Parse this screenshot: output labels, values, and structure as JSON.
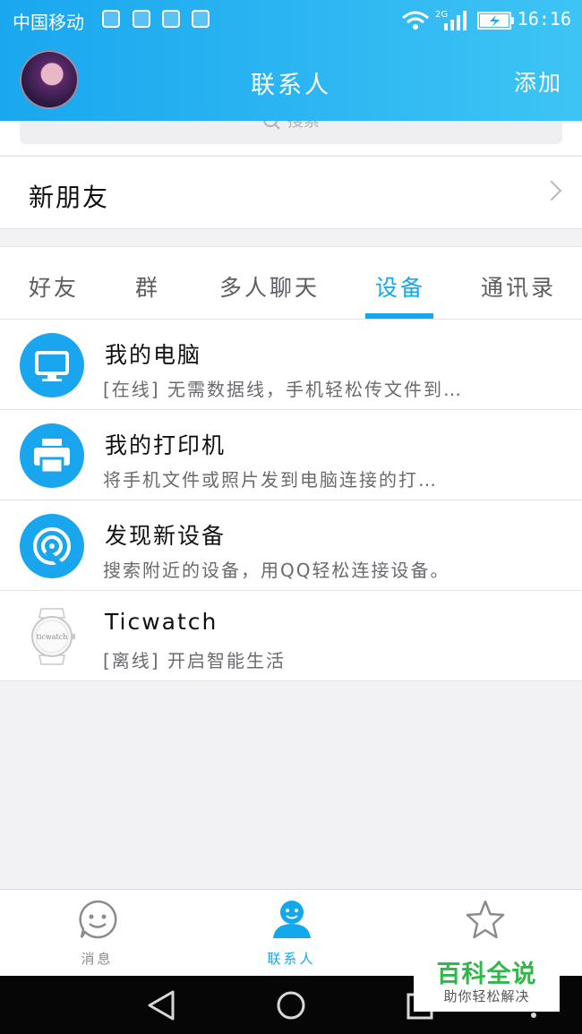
{
  "status_bar": {
    "carrier": "中国移动",
    "network": "2G",
    "time": "16:16",
    "notification_icons": [
      "notification-app-icon",
      "notification-mic-icon",
      "notification-android-icon",
      "notification-gallery-icon"
    ]
  },
  "header": {
    "title": "联系人",
    "add_label": "添加"
  },
  "search": {
    "placeholder": "搜索"
  },
  "new_friends": {
    "label": "新朋友"
  },
  "tabs": [
    {
      "label": "好友",
      "active": false
    },
    {
      "label": "群",
      "active": false
    },
    {
      "label": "多人聊天",
      "active": false
    },
    {
      "label": "设备",
      "active": true
    },
    {
      "label": "通讯录",
      "active": false
    }
  ],
  "devices": [
    {
      "title": "我的电脑",
      "subtitle": "[在线] 无需数据线，手机轻松传文件到…",
      "icon": "computer-icon"
    },
    {
      "title": "我的打印机",
      "subtitle": "将手机文件或照片发到电脑连接的打…",
      "icon": "printer-icon"
    },
    {
      "title": "发现新设备",
      "subtitle": "搜索附近的设备，用QQ轻松连接设备。",
      "icon": "radar-icon"
    },
    {
      "title": "Ticwatch",
      "subtitle": "[离线] 开启智能生活",
      "icon": "watch-icon",
      "watch_text": "ticwatch"
    }
  ],
  "tabbar": [
    {
      "label": "消息",
      "icon": "smiley-icon",
      "active": false
    },
    {
      "label": "联系人",
      "icon": "contacts-icon",
      "active": true
    },
    {
      "label": "",
      "icon": "star-icon",
      "active": false
    }
  ],
  "watermark": {
    "main": "百科全说",
    "sub": "助你轻松解决"
  },
  "colors": {
    "accent": "#13a7ee",
    "header_start": "#1aa7ef",
    "header_end": "#3ec4f4",
    "watermark_green": "#2fb84a"
  }
}
